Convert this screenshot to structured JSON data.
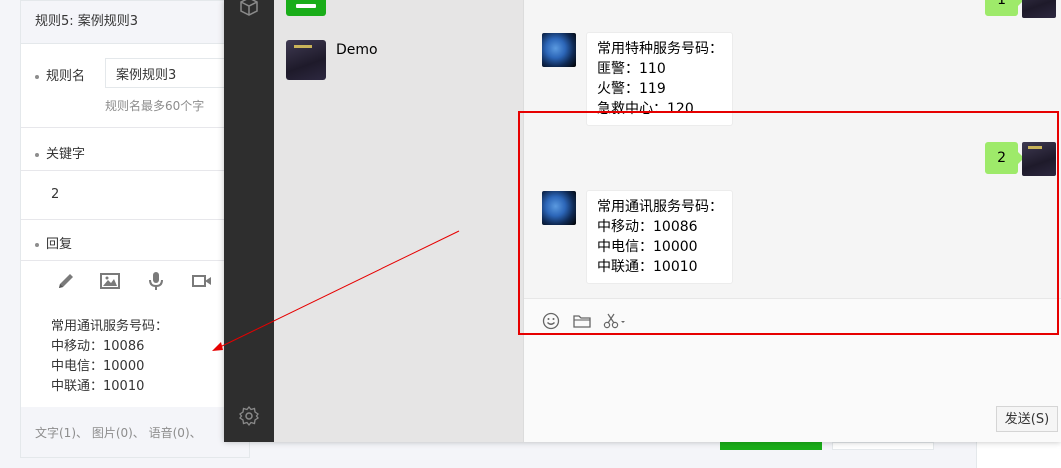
{
  "rule": {
    "title": "规则5: 案例规则3",
    "name_label": "规则名",
    "name_value": "案例规则3",
    "name_hint": "规则名最多60个字",
    "keyword_label": "关键字",
    "keyword_value": "2",
    "reply_label": "回复",
    "tools": [
      {
        "icon": "pencil-icon"
      },
      {
        "icon": "image-icon"
      },
      {
        "icon": "microphone-icon"
      },
      {
        "icon": "video-icon"
      }
    ],
    "reply_text": "常用通讯服务号码：\n中移动：10086\n中电信：10000\n中联通：10010",
    "footer_counts": "文字(1)、 图片(0)、 语音(0)、"
  },
  "wechat": {
    "contact_name": "Demo",
    "outgoing_top": "1",
    "msg_special": "常用特种服务号码：\n匪警：110\n火警：119\n急救中心：120",
    "outgoing_keyword": "2",
    "msg_telecom": "常用通讯服务号码：\n中移动：10086\n中电信：10000\n中联通：10010",
    "send_label": "发送(S)",
    "input_tools": [
      {
        "icon": "emoji-icon"
      },
      {
        "icon": "folder-icon"
      },
      {
        "icon": "scissors-icon"
      }
    ]
  },
  "colors": {
    "highlight_box": "#e60000",
    "outgoing_bubble": "#9eea6a",
    "nav_bg": "#2e2e2e"
  }
}
